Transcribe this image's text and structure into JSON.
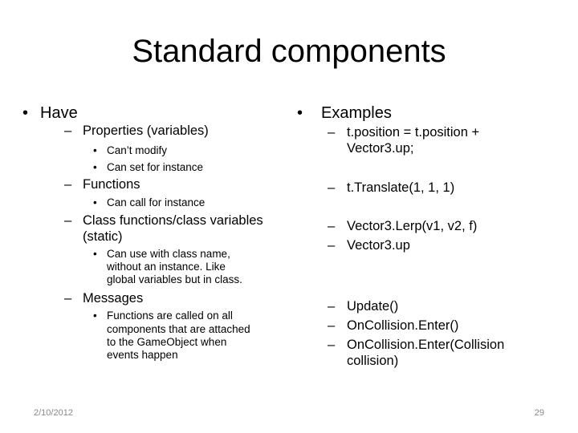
{
  "title": "Standard components",
  "left": {
    "heading": "Have",
    "properties": "Properties (variables)",
    "properties_sub": [
      "Can’t modify",
      "Can set for instance"
    ],
    "functions": "Functions",
    "functions_sub": [
      "Can call for instance"
    ],
    "class_line1": "Class functions/class variables",
    "class_line2": "(static)",
    "class_sub": [
      "Can use with class name,",
      "without an instance. Like",
      "global variables but in class."
    ],
    "messages": "Messages",
    "messages_sub": [
      "Functions are called on all",
      "components that are attached",
      "to the GameObject when",
      "events happen"
    ]
  },
  "right": {
    "heading": "Examples",
    "ex1_line1": "t.position = t.position +",
    "ex1_line2": "Vector3.up;",
    "ex2": "t.Translate(1, 1, 1)",
    "ex3": "Vector3.Lerp(v1, v2, f)",
    "ex4": "Vector3.up",
    "ex5": "Update()",
    "ex6": "OnCollision.Enter()",
    "ex7_line1": "OnCollision.Enter(Collision",
    "ex7_line2": "collision)"
  },
  "footer": {
    "date": "2/10/2012",
    "page": "29"
  },
  "glyphs": {
    "bullet": "•",
    "dash": "–"
  }
}
